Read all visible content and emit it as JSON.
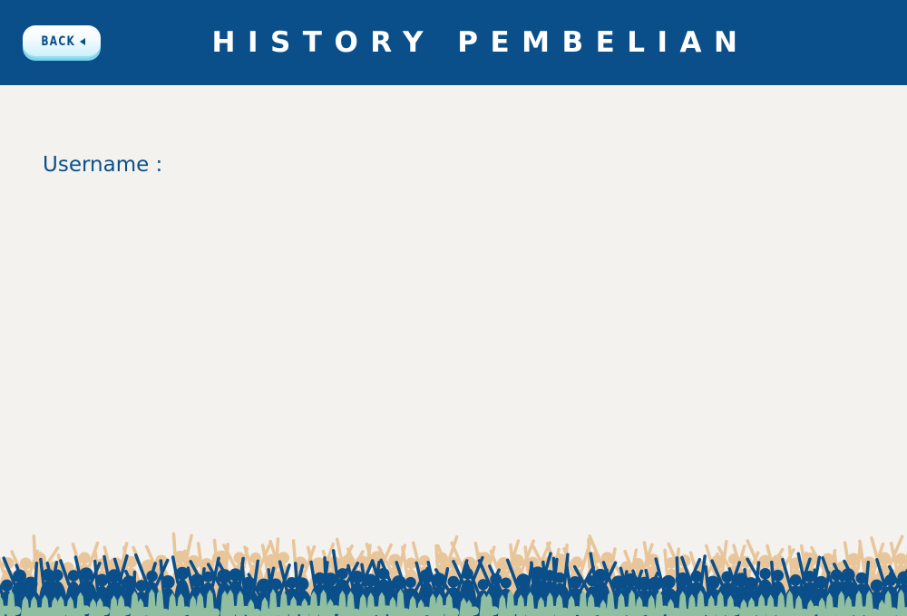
{
  "header": {
    "title": "HISTORY PEMBELIAN",
    "back_label": "BACK"
  },
  "main": {
    "username_label": "Username :"
  },
  "colors": {
    "primary": "#0b4f8a",
    "background": "#f3f2ef",
    "crowd_back": "#e9c59a",
    "crowd_front": "#0b4f8a",
    "crowd_hands": "#8fbfa0"
  },
  "icons": {
    "back": "triangle-left-icon"
  }
}
